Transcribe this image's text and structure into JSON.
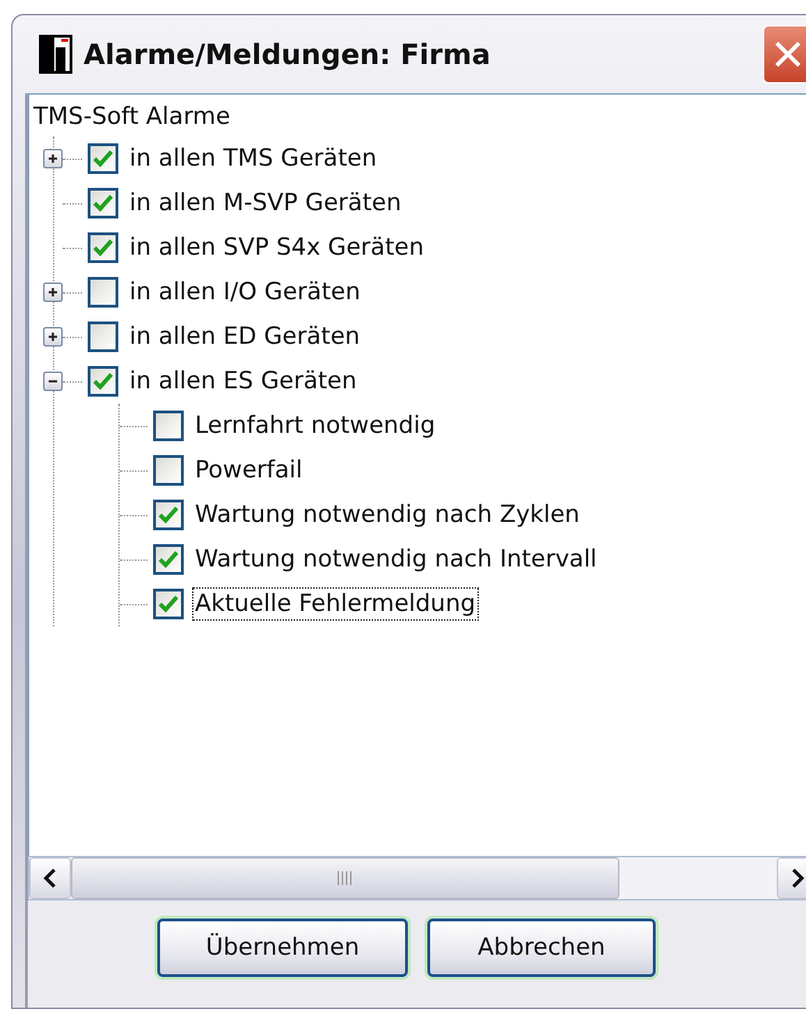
{
  "window": {
    "title": "Alarme/Meldungen: Firma"
  },
  "tree": {
    "root": "TMS-Soft Alarme",
    "items": [
      {
        "label": "in allen TMS Geräten",
        "kind": "group",
        "expanded": false,
        "checked": true,
        "selected": false
      },
      {
        "label": "in allen M-SVP Geräten",
        "kind": "leaf",
        "checked": true,
        "selected": false
      },
      {
        "label": "in allen SVP S4x Geräten",
        "kind": "leaf",
        "checked": true,
        "selected": false
      },
      {
        "label": "in allen I/O Geräten",
        "kind": "group",
        "expanded": false,
        "checked": false,
        "selected": false
      },
      {
        "label": "in allen ED Geräten",
        "kind": "group",
        "expanded": false,
        "checked": false,
        "selected": false
      },
      {
        "label": "in allen ES Geräten",
        "kind": "group",
        "expanded": true,
        "checked": true,
        "selected": false,
        "children": [
          {
            "label": "Lernfahrt notwendig",
            "checked": false,
            "selected": false
          },
          {
            "label": "Powerfail",
            "checked": false,
            "selected": false
          },
          {
            "label": "Wartung notwendig nach Zyklen",
            "checked": true,
            "selected": false
          },
          {
            "label": "Wartung notwendig nach Intervall",
            "checked": true,
            "selected": false
          },
          {
            "label": "Aktuelle Fehlermeldung",
            "checked": true,
            "selected": true
          }
        ]
      }
    ]
  },
  "buttons": [
    "Übernehmen",
    "Abbrechen"
  ]
}
